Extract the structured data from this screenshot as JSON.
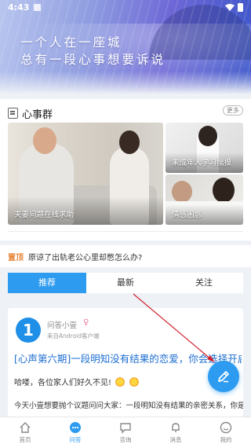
{
  "status_bar": {
    "time": "4:43"
  },
  "hero": {
    "line1": "一个人在一座城",
    "line2": "总有一段心事想要诉说"
  },
  "section": {
    "title": "心事群",
    "more_label": "更多",
    "tiles": [
      {
        "label": "夫妻问题在线求助"
      },
      {
        "label": "未成年人学习揣摸"
      },
      {
        "label": "情感困惑"
      }
    ]
  },
  "notice": {
    "tag": "置顶",
    "text": "原谅了出轨老公心里却憋怎么办?"
  },
  "tabs": [
    "推荐",
    "最新",
    "关注"
  ],
  "post": {
    "avatar_text": "1",
    "author": "问答小壹",
    "source": "来自Android客户端",
    "title": "[心声第六期]一段明知没有结果的恋爱，你会选择开启吗?",
    "greeting": "哈喽，各位家人们好久不见!",
    "excerpt": "今天小壹想要抛个议题问问大家：一段明知没有结果的亲密关系，你是否会"
  },
  "bottom_nav": [
    {
      "label": "首页",
      "icon": "home-icon"
    },
    {
      "label": "问答",
      "icon": "qa-icon"
    },
    {
      "label": "咨询",
      "icon": "chat-icon"
    },
    {
      "label": "消息",
      "icon": "bell-icon"
    },
    {
      "label": "我的",
      "icon": "profile-icon"
    }
  ],
  "colors": {
    "accent": "#2d9bf0",
    "notice_tag": "#e8873a",
    "post_title": "#1e6fd0"
  }
}
